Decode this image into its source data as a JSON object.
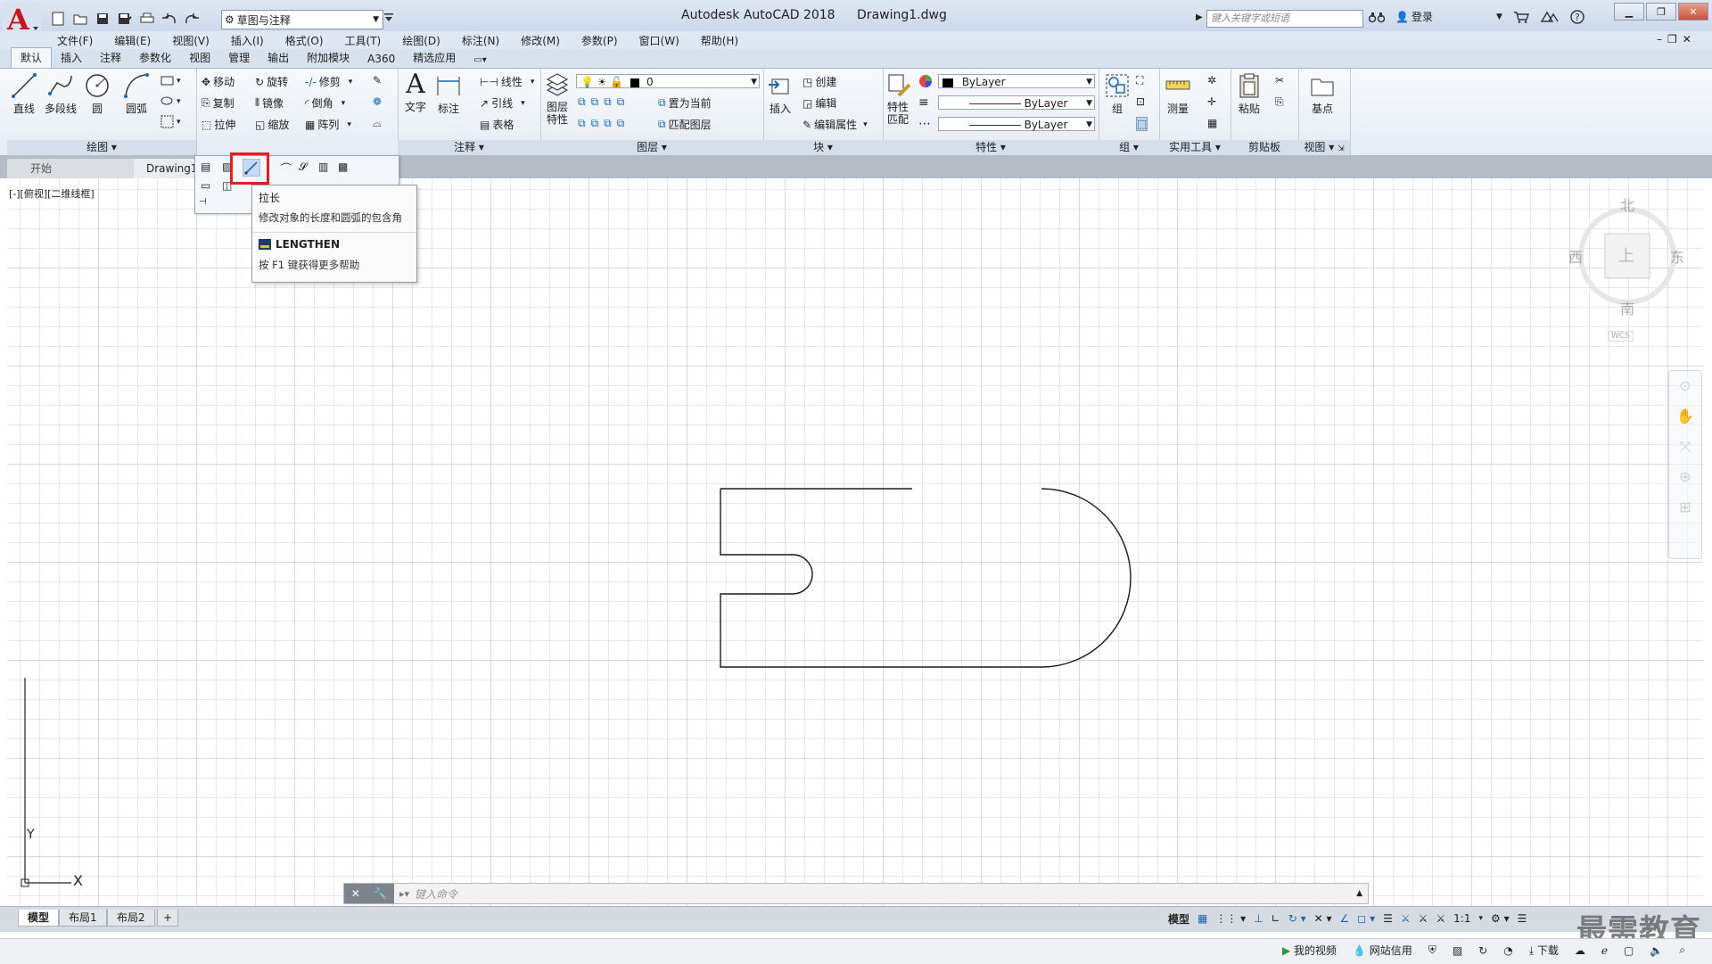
{
  "window": {
    "title": "Autodesk AutoCAD 2018",
    "document": "Drawing1.dwg",
    "workspace": "草图与注释",
    "search_placeholder": "键入关键字或短语",
    "login": "登录"
  },
  "menu": [
    "文件(F)",
    "编辑(E)",
    "视图(V)",
    "插入(I)",
    "格式(O)",
    "工具(T)",
    "绘图(D)",
    "标注(N)",
    "修改(M)",
    "参数(P)",
    "窗口(W)",
    "帮助(H)"
  ],
  "ribbon_tabs": [
    "默认",
    "插入",
    "注释",
    "参数化",
    "视图",
    "管理",
    "输出",
    "附加模块",
    "A360",
    "精选应用"
  ],
  "panels": {
    "draw": {
      "title": "绘图",
      "items": [
        "直线",
        "多段线",
        "圆",
        "圆弧"
      ]
    },
    "modify": {
      "items": [
        "移动",
        "旋转",
        "修剪",
        "复制",
        "镜像",
        "倒角",
        "拉伸",
        "缩放",
        "阵列"
      ]
    },
    "annotation": {
      "title": "注释",
      "items": [
        "文字",
        "标注",
        "线性",
        "引线",
        "表格"
      ]
    },
    "layers": {
      "title": "图层",
      "layer_props": "图层特性",
      "current_layer": "0",
      "items": [
        "置为当前",
        "匹配图层"
      ]
    },
    "block": {
      "title": "块",
      "items": [
        "插入",
        "创建",
        "编辑",
        "编辑属性"
      ]
    },
    "properties": {
      "title": "特性",
      "match": "特性匹配",
      "color": "ByLayer",
      "linetype": "ByLayer",
      "lineweight": "ByLayer"
    },
    "groups": {
      "title": "组",
      "item": "组"
    },
    "utilities": {
      "title": "实用工具",
      "item": "测量"
    },
    "clipboard": {
      "title": "剪贴板",
      "item": "粘贴"
    },
    "view": {
      "title": "视图",
      "item": "基点"
    }
  },
  "file_tabs": [
    "开始",
    "Drawing1"
  ],
  "viewport_label": "[-][俯视][二维线框]",
  "tooltip": {
    "title": "拉长",
    "description": "修改对象的长度和圆弧的包含角",
    "command": "LENGTHEN",
    "help": "按 F1 键获得更多帮助"
  },
  "viewcube": {
    "north": "北",
    "south": "南",
    "east": "东",
    "west": "西",
    "top": "上",
    "wcs": "WCS"
  },
  "ucs": {
    "x": "X",
    "y": "Y"
  },
  "command_placeholder": "键入命令",
  "layout_tabs": [
    "模型",
    "布局1",
    "布局2",
    "+"
  ],
  "status": {
    "model": "模型",
    "scale": "1:1"
  },
  "taskbar": [
    "我的视频",
    "网站信用",
    "下载"
  ],
  "watermark": "最需教育",
  "colors": {
    "accent": "#d22020",
    "ribbon_bg": "#eef2f8",
    "grid": "#c8c8c8"
  }
}
